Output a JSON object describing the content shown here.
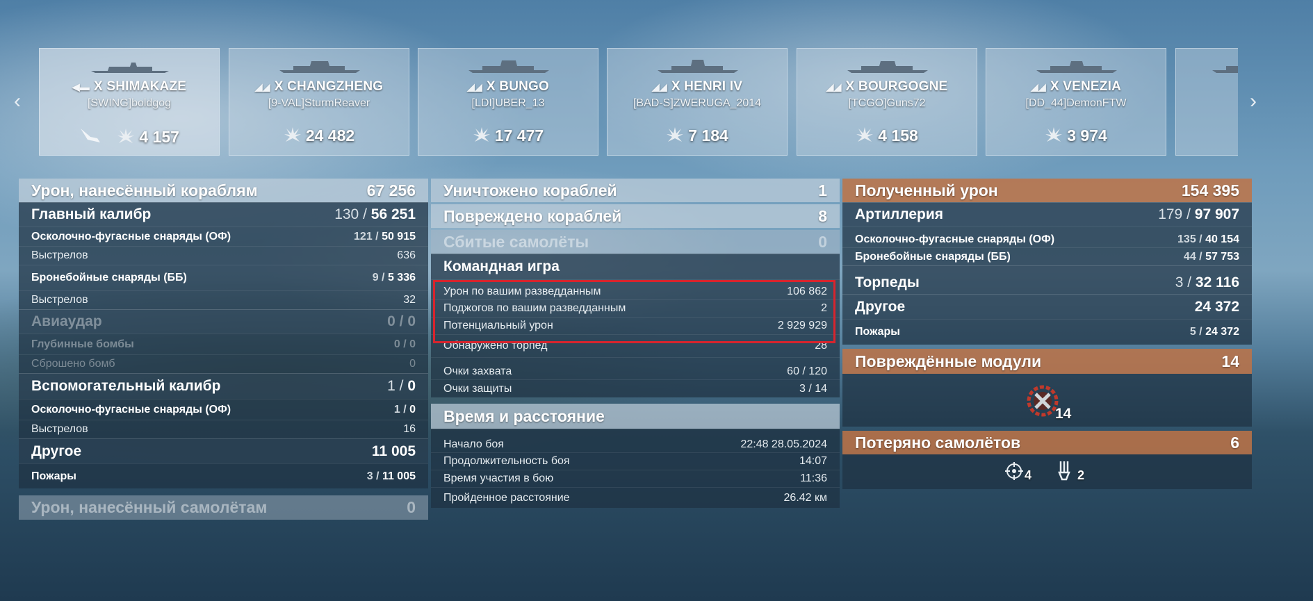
{
  "nav": {
    "prev_icon": "chevron-left-icon",
    "next_icon": "chevron-right-icon",
    "prev_glyph": "‹",
    "next_glyph": "›"
  },
  "ships": [
    {
      "cls_icon": "destroyer-class-icon",
      "tier": "X",
      "name": "SHIMAKAZE",
      "player": "[SWING]boldgog",
      "extra_icon": "torpedo-hit-icon",
      "score_icon": "damage-icon",
      "score": "4 157"
    },
    {
      "cls_icon": "battleship-class-icon",
      "tier": "X",
      "name": "CHANGZHENG",
      "player": "[9-VAL]SturmReaver",
      "score_icon": "damage-icon",
      "score": "24 482"
    },
    {
      "cls_icon": "battleship-class-icon",
      "tier": "X",
      "name": "BUNGO",
      "player": "[LDI]UBER_13",
      "score_icon": "damage-icon",
      "score": "17 477"
    },
    {
      "cls_icon": "battleship-class-icon",
      "tier": "X",
      "name": "HENRI IV",
      "player": "[BAD-S]ZWERUGA_2014",
      "score_icon": "damage-icon",
      "score": "7 184"
    },
    {
      "cls_icon": "battleship-class-icon",
      "tier": "X",
      "name": "BOURGOGNE",
      "player": "[TCGO]Guns72",
      "score_icon": "damage-icon",
      "score": "4 158"
    },
    {
      "cls_icon": "battleship-class-icon",
      "tier": "X",
      "name": "VENEZIA",
      "player": "[DD_44]DemonFTW",
      "score_icon": "damage-icon",
      "score": "3 974"
    }
  ],
  "left": {
    "ship_damage": {
      "label": "Урон, нанесённый кораблям",
      "value": "67 256"
    },
    "main_battery": {
      "label": "Главный калибр",
      "hits": "130",
      "dmg": "56 251"
    },
    "he1": {
      "label": "Осколочно-фугасные снаряды (ОФ)",
      "hits": "121",
      "dmg": "50 915"
    },
    "shots1": {
      "label": "Выстрелов",
      "value": "636"
    },
    "ap1": {
      "label": "Бронебойные снаряды (ББ)",
      "hits": "9",
      "dmg": "5 336"
    },
    "shots2": {
      "label": "Выстрелов",
      "value": "32"
    },
    "airstrike": {
      "label": "Авиаудар",
      "hits": "0",
      "dmg": "0"
    },
    "depth": {
      "label": "Глубинные бомбы",
      "hits": "0",
      "dmg": "0"
    },
    "bombs": {
      "label": "Сброшено бомб",
      "value": "0"
    },
    "secondary": {
      "label": "Вспомогательный калибр",
      "hits": "1",
      "dmg": "0"
    },
    "he2": {
      "label": "Осколочно-фугасные снаряды (ОФ)",
      "hits": "1",
      "dmg": "0"
    },
    "shots3": {
      "label": "Выстрелов",
      "value": "16"
    },
    "other": {
      "label": "Другое",
      "value": "11 005"
    },
    "fires": {
      "label": "Пожары",
      "hits": "3",
      "dmg": "11 005"
    },
    "plane_damage": {
      "label": "Урон, нанесённый самолётам",
      "value": "0"
    }
  },
  "middle": {
    "destroyed": {
      "label": "Уничтожено кораблей",
      "value": "1"
    },
    "damaged": {
      "label": "Повреждено кораблей",
      "value": "8"
    },
    "planes_shot": {
      "label": "Сбитые самолёты",
      "value": "0"
    },
    "team": {
      "label": "Командная игра"
    },
    "spot_dmg": {
      "label": "Урон по вашим разведданным",
      "value": "106 862"
    },
    "spot_fires": {
      "label": "Поджогов по вашим разведданным",
      "value": "2"
    },
    "potential": {
      "label": "Потенциальный урон",
      "value": "2 929 929"
    },
    "torp_spotted": {
      "label": "Обнаружено торпед",
      "value": "28"
    },
    "capture": {
      "label": "Очки захвата",
      "value": "60 / 120"
    },
    "defense": {
      "label": "Очки защиты",
      "value": "3 / 14"
    },
    "time_header": {
      "label": "Время и расстояние"
    },
    "start": {
      "label": "Начало боя",
      "value": "22:48  28.05.2024"
    },
    "duration": {
      "label": "Продолжительность боя",
      "value": "14:07"
    },
    "participation": {
      "label": "Время участия в бою",
      "value": "11:36"
    },
    "distance": {
      "label": "Пройденное расстояние",
      "value": "26.42 км"
    }
  },
  "right": {
    "received": {
      "label": "Полученный урон",
      "value": "154 395"
    },
    "artillery": {
      "label": "Артиллерия",
      "hits": "179",
      "dmg": "97 907"
    },
    "he": {
      "label": "Осколочно-фугасные снаряды (ОФ)",
      "hits": "135",
      "dmg": "40 154"
    },
    "ap": {
      "label": "Бронебойные снаряды (ББ)",
      "hits": "44",
      "dmg": "57 753"
    },
    "torpedoes": {
      "label": "Торпеды",
      "hits": "3",
      "dmg": "32 116"
    },
    "other": {
      "label": "Другое",
      "value": "24 372"
    },
    "fires": {
      "label": "Пожары",
      "hits": "5",
      "dmg": "24 372"
    },
    "modules": {
      "label": "Повреждённые модули",
      "value": "14",
      "icon": "damaged-module-icon",
      "icon_count": "14"
    },
    "planes_lost": {
      "label": "Потеряно самолётов",
      "value": "6",
      "fighter_icon": "crosshair-icon",
      "fighter_count": "4",
      "other_icon": "aa-icon",
      "other_count": "2"
    }
  },
  "colors": {
    "highlight_box": "#d8242d",
    "section_orange": "#be7346"
  }
}
